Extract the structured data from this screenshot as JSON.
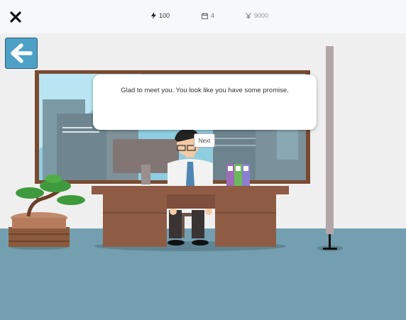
{
  "topbar": {
    "energy_value": "100",
    "days_value": "4",
    "money_value": "9000",
    "close_icon": "close-icon",
    "energy_icon": "lightning-icon",
    "days_icon": "calendar-icon",
    "money_icon": "yen-icon"
  },
  "scene": {
    "back_icon": "arrow-left-icon",
    "dialog_text": "Glad to meet you. You look like you have some promise.",
    "next_label": "Next"
  },
  "colors": {
    "floor": "#739fb0",
    "wall": "#efefef",
    "back_button": "#4ea1c6",
    "desk": "#8e5c45",
    "window_frame": "#7a4a30"
  }
}
